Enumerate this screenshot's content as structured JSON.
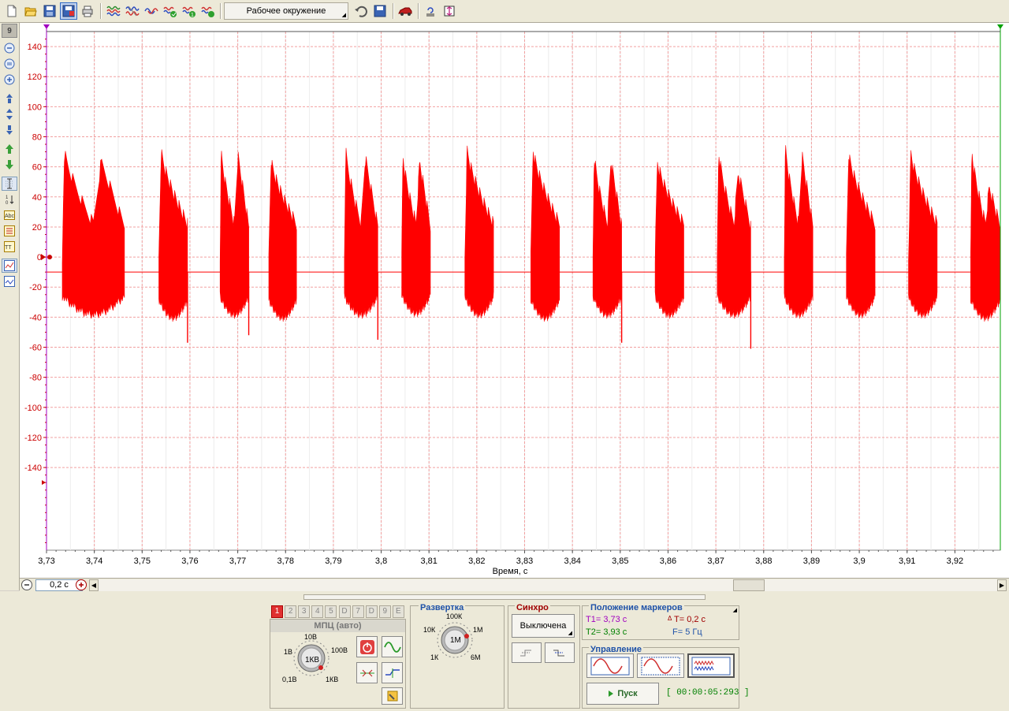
{
  "toolbar": {
    "environment_label": "Рабочее окружение"
  },
  "left_toolbar": {
    "channel_number": "9"
  },
  "chart_data": {
    "type": "line",
    "xlabel": "Время, с",
    "ylabel": "",
    "xlim": [
      3.73,
      3.9295
    ],
    "ylim": [
      -195,
      150
    ],
    "x_ticks": [
      "3,73",
      "3,74",
      "3,75",
      "3,76",
      "3,77",
      "3,78",
      "3,79",
      "3,8",
      "3,81",
      "3,82",
      "3,83",
      "3,84",
      "3,85",
      "3,86",
      "3,87",
      "3,88",
      "3,89",
      "3,9",
      "3,91",
      "3,92"
    ],
    "y_ticks": [
      "140",
      "120",
      "100",
      "80",
      "60",
      "40",
      "20",
      "0",
      "-20",
      "-40",
      "-60",
      "-80",
      "-100",
      "-120",
      "-140"
    ],
    "grid": true,
    "trace_color": "#ff0000",
    "baseline": -10,
    "series": [
      {
        "bursts": [
          {
            "start": 3.7333,
            "end": 3.7463,
            "peaks": [
              72,
              63
            ],
            "trough": -38
          },
          {
            "start": 3.7535,
            "end": 3.7595,
            "peaks": [
              71
            ],
            "trough": -40,
            "spike": -57
          },
          {
            "start": 3.7663,
            "end": 3.7723,
            "peaks": [
              71,
              67
            ],
            "trough": -38,
            "spike": -52
          },
          {
            "start": 3.7765,
            "end": 3.7823,
            "peaks": [
              65
            ],
            "trough": -40
          },
          {
            "start": 3.7923,
            "end": 3.7993,
            "peaks": [
              72,
              66
            ],
            "trough": -38,
            "spike": -55
          },
          {
            "start": 3.8043,
            "end": 3.8103,
            "peaks": [
              69,
              63
            ],
            "trough": -37
          },
          {
            "start": 3.8175,
            "end": 3.8235,
            "peaks": [
              72
            ],
            "trough": -38
          },
          {
            "start": 3.8313,
            "end": 3.8373,
            "peaks": [
              72
            ],
            "trough": -40
          },
          {
            "start": 3.8443,
            "end": 3.8503,
            "peaks": [
              69,
              64
            ],
            "trough": -38,
            "spike": -57
          },
          {
            "start": 3.8573,
            "end": 3.8633,
            "peaks": [
              64
            ],
            "trough": -38
          },
          {
            "start": 3.8703,
            "end": 3.8773,
            "peaks": [
              72,
              56
            ],
            "trough": -38,
            "spike": -61
          },
          {
            "start": 3.8843,
            "end": 3.8903,
            "peaks": [
              75,
              67
            ],
            "trough": -38
          },
          {
            "start": 3.8973,
            "end": 3.9033,
            "peaks": [
              69
            ],
            "trough": -38
          },
          {
            "start": 3.9103,
            "end": 3.9163,
            "peaks": [
              70
            ],
            "trough": -38
          },
          {
            "start": 3.9233,
            "end": 3.9295,
            "peaks": [
              72,
              46
            ],
            "trough": -40
          }
        ]
      }
    ]
  },
  "scale": {
    "value": "0,2 с"
  },
  "channels": {
    "tabs": [
      "1",
      "2",
      "3",
      "4",
      "5",
      "D",
      "7",
      "D",
      "9",
      "E"
    ],
    "mode_title": "МПЦ (авто)",
    "knob_labels": [
      "10В",
      "1В",
      "100В",
      "0,1В",
      "1КВ"
    ],
    "knob_value": "1КВ"
  },
  "sweep": {
    "title": "Развертка",
    "knob_labels": [
      "100К",
      "10К",
      "1М",
      "1К",
      "6М"
    ],
    "knob_value": "1М"
  },
  "sync": {
    "title": "Синхро",
    "mode": "Выключена"
  },
  "markers": {
    "title": "Положение маркеров",
    "t1": "T1= 3,73 с",
    "t2": "T2= 3,93 с",
    "dt": "T= 0,2 с",
    "f": "F= 5 Гц"
  },
  "control": {
    "title": "Управление",
    "run_label": "Пуск",
    "timer": "[ 00:00:05:293 ]"
  },
  "colors": {
    "trace": "#ff0000",
    "grid": "#f2a0a0",
    "marker1": "#a000c0",
    "marker2": "#00a000",
    "panel_blue": "#1f52a8",
    "sync_red": "#a00000",
    "timer_green": "#008000"
  }
}
